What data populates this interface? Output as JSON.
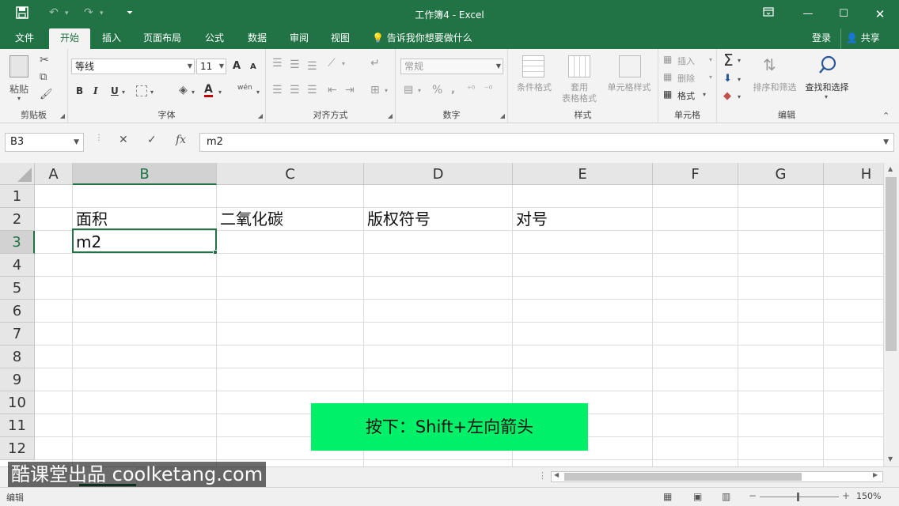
{
  "window": {
    "title": "工作簿4 - Excel",
    "save_icon": "save-icon",
    "undo_icon": "undo-icon",
    "redo_icon": "redo-icon",
    "customize_icon": "customize-qat-icon",
    "ribbon_options_icon": "ribbon-display-options-icon",
    "minimize_icon": "minimize-icon",
    "maximize_icon": "maximize-icon",
    "close_icon": "close-icon"
  },
  "tabs": [
    "文件",
    "开始",
    "插入",
    "页面布局",
    "公式",
    "数据",
    "审阅",
    "视图"
  ],
  "active_tab": "开始",
  "tell_me": "告诉我你想要做什么",
  "login": "登录",
  "share": "共享",
  "ribbon": {
    "clipboard": {
      "label": "剪贴板",
      "paste": "粘贴"
    },
    "font": {
      "label": "字体",
      "font_name": "等线",
      "font_size": "11",
      "bold": "B",
      "italic": "I",
      "underline": "U",
      "grow": "A",
      "shrink": "A",
      "font_color": "A",
      "phonetic": "wén"
    },
    "alignment": {
      "label": "对齐方式"
    },
    "number": {
      "label": "数字",
      "format": "常规",
      "percent": "%"
    },
    "styles": {
      "label": "样式",
      "conditional": "条件格式",
      "table": "套用",
      "table2": "表格格式",
      "cell_styles": "单元格样式"
    },
    "cells": {
      "label": "单元格",
      "insert": "插入",
      "delete": "删除",
      "format": "格式"
    },
    "editing": {
      "label": "编辑",
      "sort": "排序和筛选",
      "find": "查找和选择"
    }
  },
  "formula_bar": {
    "name_box": "B3",
    "cancel": "✕",
    "enter": "✓",
    "fx": "fx",
    "content": "m2"
  },
  "columns": [
    "A",
    "B",
    "C",
    "D",
    "E",
    "F",
    "G",
    "H"
  ],
  "rows": [
    "1",
    "2",
    "3",
    "4",
    "5",
    "6",
    "7",
    "8",
    "9",
    "10",
    "11",
    "12"
  ],
  "selected_column": "B",
  "selected_row": "3",
  "cells": {
    "B2": "面积",
    "C2": "二氧化碳",
    "D2": "版权符号",
    "E2": "对号",
    "B3": "m2"
  },
  "hint": "按下：Shift+左向箭头",
  "watermark": "酷课堂出品 coolketang.com",
  "status": {
    "mode": "编辑",
    "zoom": "150%"
  },
  "colors": {
    "accent": "#217346",
    "hint_bg": "#00f06a"
  }
}
